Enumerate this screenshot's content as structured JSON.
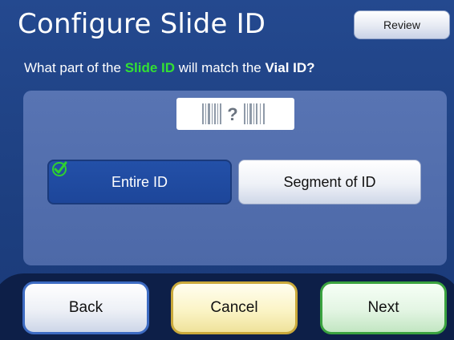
{
  "header": {
    "title": "Configure Slide ID",
    "review_label": "Review"
  },
  "question": {
    "prefix": "What part of the ",
    "slide_id": "Slide ID",
    "middle": " will match the ",
    "vial_id": "Vial ID?"
  },
  "barcode": {
    "icon": "barcode-question-icon",
    "glyph": "?"
  },
  "options": {
    "entire_id": "Entire ID",
    "segment_id": "Segment of ID",
    "selected": "Entire ID"
  },
  "footer": {
    "back_label": "Back",
    "cancel_label": "Cancel",
    "next_label": "Next"
  },
  "colors": {
    "background": "#1d3f80",
    "panel": "#4d69a8",
    "highlight_green": "#33e033",
    "selected_option": "#1d469a",
    "back_border": "#3d6bc2",
    "cancel_border": "#c9a93b",
    "next_border": "#3aa23f"
  }
}
